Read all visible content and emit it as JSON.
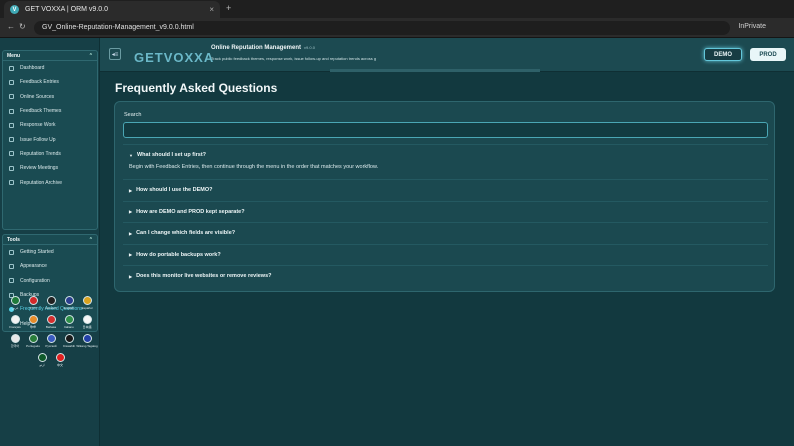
{
  "browser": {
    "tab_title": "GET VOXXA | ORM v9.0.0",
    "tab_icon": "V",
    "tab_close": "×",
    "new_tab": "+",
    "back": "←",
    "reload": "↻",
    "url": "GV_Online-Reputation-Management_v9.0.0.html",
    "inprivate": "InPrivate"
  },
  "header": {
    "logo": "GETVOXXA",
    "title": "Online Reputation Management",
    "version": "v9.0.0",
    "subtitle": "Track public feedback themes, response work, issue follow-up and reputation trends across g",
    "collapse_icon": "◂≡",
    "env_demo": "DEMO",
    "env_prod": "PROD",
    "active_env": "DEMO"
  },
  "sidebar": {
    "menu_title": "Menu",
    "menu_items": [
      {
        "label": "Dashboard"
      },
      {
        "label": "Feedback Entries"
      },
      {
        "label": "Online Sources"
      },
      {
        "label": "Feedback Themes"
      },
      {
        "label": "Response Work"
      },
      {
        "label": "Issue Follow Up"
      },
      {
        "label": "Reputation Trends"
      },
      {
        "label": "Review Meetings"
      },
      {
        "label": "Reputation Archive"
      }
    ],
    "tools_title": "Tools",
    "tools_items": [
      {
        "label": "Getting Started"
      },
      {
        "label": "Appearance"
      },
      {
        "label": "Configuration"
      },
      {
        "label": "Backups"
      },
      {
        "label": "Frequently Asked Questions",
        "active": true
      }
    ],
    "help_label": "Help",
    "collapse_chevron": "⌃",
    "flags": [
      {
        "label": "عربي",
        "color": "#1f7a3a"
      },
      {
        "label": "বাংলা",
        "color": "#d32a2a"
      },
      {
        "label": "Deutsch",
        "color": "#222222"
      },
      {
        "label": "English",
        "color": "#2b3f8f"
      },
      {
        "label": "Español",
        "color": "#d9a21f"
      },
      {
        "label": "Français",
        "color": "#f3f3f3"
      },
      {
        "label": "हिन्दी",
        "color": "#e58c2a"
      },
      {
        "label": "Bahasa",
        "color": "#d42f2f"
      },
      {
        "label": "Italiano",
        "color": "#2f8f4a"
      },
      {
        "label": "日本語",
        "color": "#f7f7f7"
      },
      {
        "label": "한국어",
        "color": "#e8e8e8"
      },
      {
        "label": "Português",
        "color": "#2a7d3a"
      },
      {
        "label": "Русский",
        "color": "#3a5bc0"
      },
      {
        "label": "Kiswahili",
        "color": "#1a1a1a"
      },
      {
        "label": "Wikang Tagalog",
        "color": "#2340a8"
      },
      {
        "label": "اردو",
        "color": "#0f5a2a"
      },
      {
        "label": "中文",
        "color": "#e02020"
      }
    ]
  },
  "main": {
    "page_title": "Frequently Asked Questions",
    "search_label": "Search",
    "search_value": "",
    "faqs": [
      {
        "q": "What should I set up first?",
        "a": "Begin with Feedback Entries, then continue through the menu in the order that matches your workflow.",
        "open": true
      },
      {
        "q": "How should I use the DEMO?",
        "open": false
      },
      {
        "q": "How are DEMO and PROD kept separate?",
        "open": false
      },
      {
        "q": "Can I change which fields are visible?",
        "open": false
      },
      {
        "q": "How do portable backups work?",
        "open": false
      },
      {
        "q": "Does this monitor live websites or remove reviews?",
        "open": false
      }
    ]
  }
}
